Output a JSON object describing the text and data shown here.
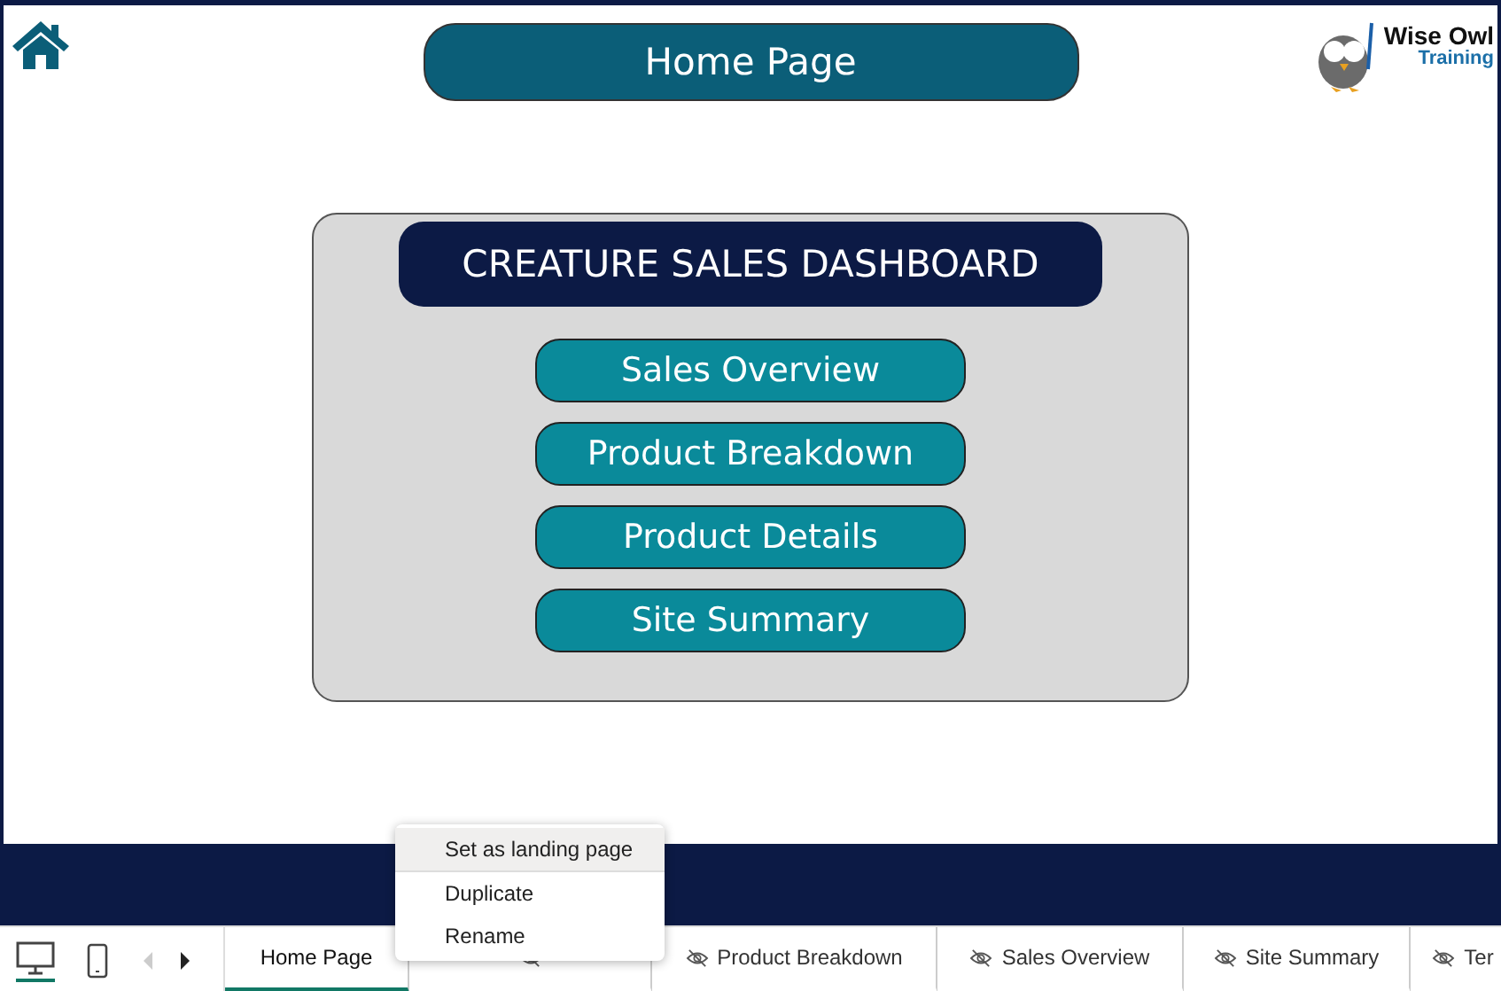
{
  "header": {
    "title": "Home Page",
    "logo": {
      "line1": "Wise Owl",
      "line2": "Training"
    }
  },
  "panel": {
    "title": "CREATURE SALES DASHBOARD",
    "buttons": [
      "Sales Overview",
      "Product Breakdown",
      "Product Details",
      "Site Summary"
    ]
  },
  "context_menu": [
    {
      "label": "Set as landing page",
      "highlighted": true
    },
    {
      "label": "Duplicate",
      "highlighted": false
    },
    {
      "label": "Rename",
      "highlighted": false
    }
  ],
  "page_tabs": [
    {
      "label": "Home Page",
      "selected": true,
      "hidden": false
    },
    {
      "selected": false,
      "hidden": true
    },
    {
      "label": "Product Breakdown",
      "selected": false,
      "hidden": true
    },
    {
      "label": "Sales Overview",
      "selected": false,
      "hidden": true
    },
    {
      "label": "Site Summary",
      "selected": false,
      "hidden": true
    },
    {
      "label": "Ter",
      "selected": false,
      "hidden": true
    }
  ]
}
